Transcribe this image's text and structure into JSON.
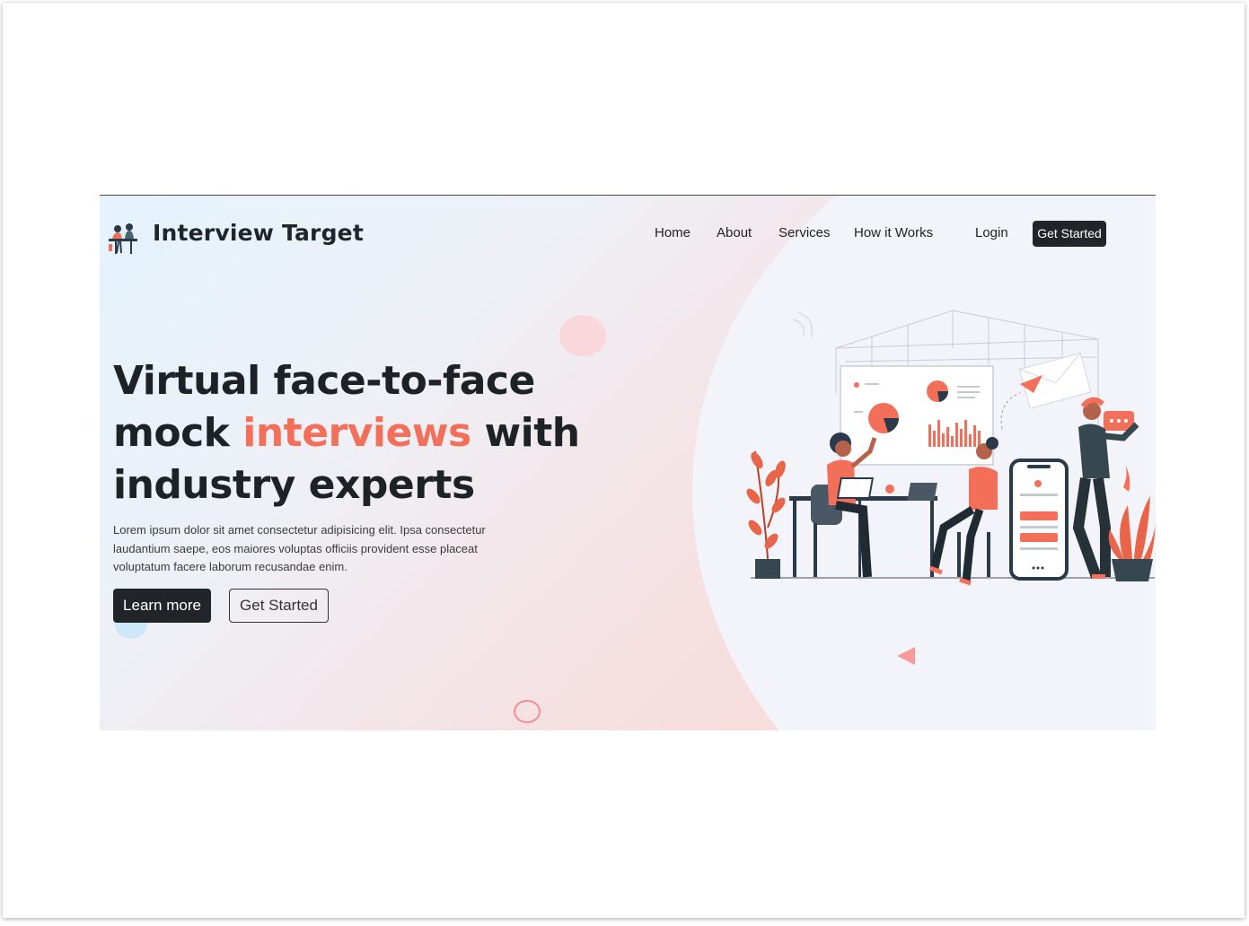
{
  "navbar": {
    "brand": "Interview Target",
    "links": [
      "Home",
      "About",
      "Services",
      "How it Works",
      "Login"
    ],
    "cta_label": "Get Started"
  },
  "hero": {
    "headline_line1": "Virtual face-to-face",
    "headline_mock": "mock",
    "headline_accent": "interviews",
    "headline_with": "with",
    "headline_line3": "industry experts",
    "description": "Lorem ipsum dolor sit amet consectetur adipisicing elit. Ipsa consectetur laudantium saepe, eos maiores voluptas officiis provident esse placeat voluptatum facere laborum recusandae enim.",
    "primary_button": "Learn more",
    "secondary_button": "Get Started"
  },
  "colors": {
    "accent": "#f46f5a",
    "dark": "#212529",
    "light_panel": "#f3f4f9"
  },
  "icons": {
    "logo": "people-at-desk-logo-icon",
    "illustration": "team-meeting-illustration"
  }
}
